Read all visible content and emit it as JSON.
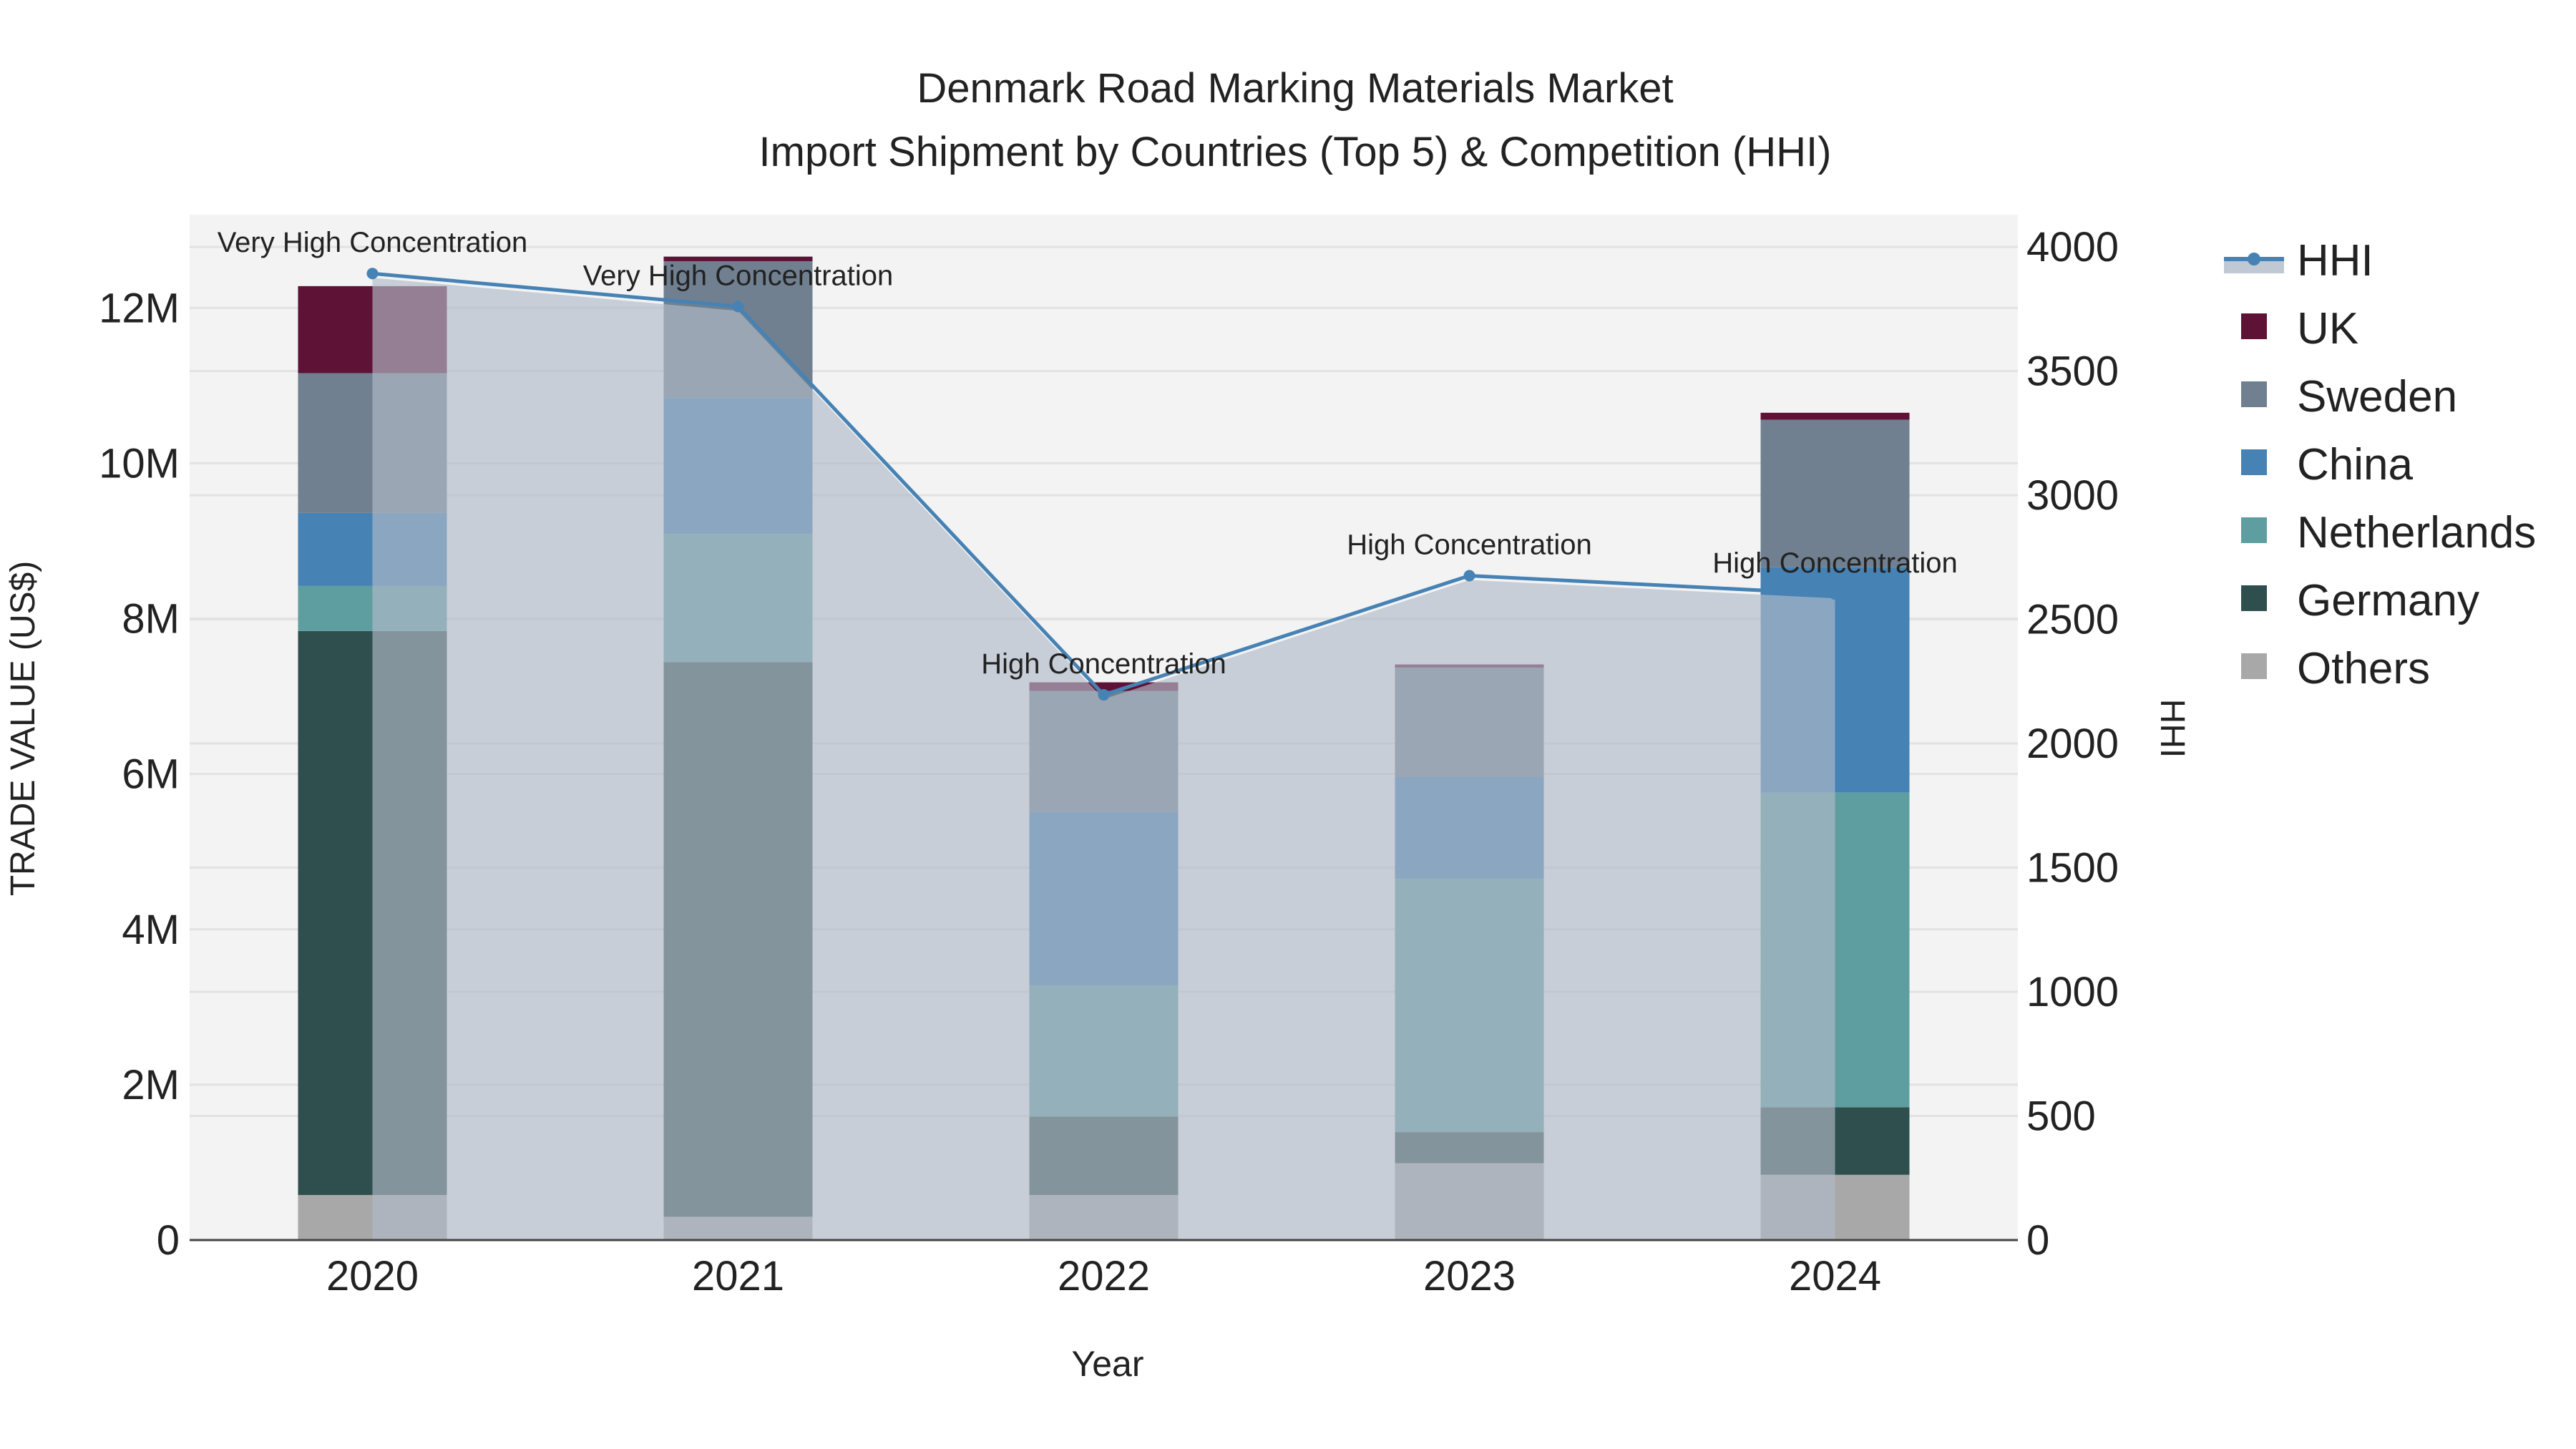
{
  "chart_data": {
    "type": "bar",
    "title_line1": "Denmark Road Marking Materials Market",
    "title_line2": "Import Shipment by Countries (Top 5) & Competition (HHI)",
    "xlabel": "Year",
    "ylabel": "TRADE VALUE (US$)",
    "y2label": "HHI",
    "categories": [
      "2020",
      "2021",
      "2022",
      "2023",
      "2024"
    ],
    "ylim": [
      0,
      13.2
    ],
    "y_unit": "M",
    "yticks": [
      0,
      2,
      4,
      6,
      8,
      10,
      12
    ],
    "ytick_labels": [
      "0",
      "2M",
      "4M",
      "6M",
      "8M",
      "10M",
      "12M"
    ],
    "y2lim": [
      0,
      4130
    ],
    "y2ticks": [
      0,
      500,
      1000,
      1500,
      2000,
      2500,
      3000,
      3500,
      4000
    ],
    "y2tick_labels": [
      "0",
      "500",
      "1000",
      "1500",
      "2000",
      "2500",
      "3000",
      "3500",
      "4000"
    ],
    "stack_order": [
      "Others",
      "Germany",
      "Netherlands",
      "China",
      "Sweden",
      "UK"
    ],
    "series": [
      {
        "name": "Others",
        "color": "#a8a8a8",
        "values": [
          0.58,
          0.3,
          0.58,
          0.99,
          0.84
        ]
      },
      {
        "name": "Germany",
        "color": "#2f4f4f",
        "values": [
          7.26,
          7.14,
          1.01,
          0.4,
          0.87
        ]
      },
      {
        "name": "Netherlands",
        "color": "#5f9ea0",
        "values": [
          0.58,
          1.65,
          1.69,
          3.26,
          4.05
        ]
      },
      {
        "name": "China",
        "color": "#4682b4",
        "values": [
          0.94,
          1.75,
          2.23,
          1.31,
          2.9
        ]
      },
      {
        "name": "Sweden",
        "color": "#708090",
        "values": [
          1.8,
          1.76,
          1.56,
          1.41,
          1.9
        ]
      },
      {
        "name": "UK",
        "color": "#5e1235",
        "values": [
          1.12,
          0.06,
          0.11,
          0.04,
          0.09
        ]
      }
    ],
    "hhi": {
      "name": "HHI",
      "color": "#4682b4",
      "values": [
        3893,
        3760,
        2196,
        2676,
        2602
      ],
      "annotations": [
        "Very High Concentration",
        "Very High Concentration",
        "High Concentration",
        "High Concentration",
        "High Concentration"
      ]
    },
    "legend": {
      "placement": "right",
      "entries": [
        "HHI",
        "UK",
        "Sweden",
        "China",
        "Netherlands",
        "Germany",
        "Others"
      ]
    },
    "grid": true
  }
}
